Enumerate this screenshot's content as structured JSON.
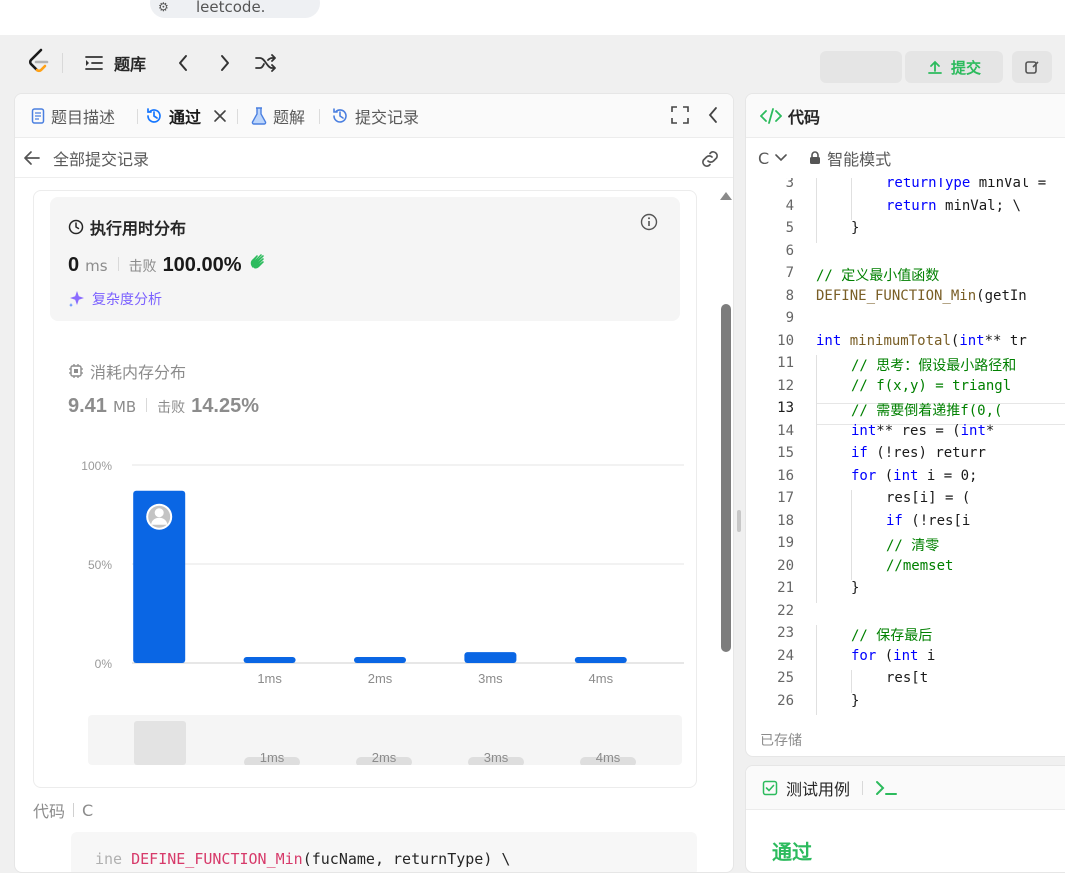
{
  "url_fragment": {
    "text": "leetcode."
  },
  "topbar": {
    "problems_label": "题库",
    "submit_label": "提交"
  },
  "left_tabs": [
    {
      "label": "题目描述",
      "icon": "document-icon"
    },
    {
      "label": "通过",
      "icon": "history-icon",
      "active": true
    },
    {
      "label": "题解",
      "icon": "flask-icon"
    },
    {
      "label": "提交记录",
      "icon": "history-icon"
    }
  ],
  "sub_header": {
    "back_label": "全部提交记录"
  },
  "runtime": {
    "title": "执行用时分布",
    "value": "0",
    "unit": "ms",
    "beats_label": "击败",
    "beats_value": "100.00%",
    "complexity_link": "复杂度分析"
  },
  "memory": {
    "title": "消耗内存分布",
    "value": "9.41",
    "unit": "MB",
    "beats_label": "击败",
    "beats_value": "14.25%"
  },
  "chart_data": {
    "type": "bar",
    "categories": [
      "0ms",
      "1ms",
      "2ms",
      "3ms",
      "4ms"
    ],
    "x_tick_labels": [
      "",
      "1ms",
      "2ms",
      "3ms",
      "4ms"
    ],
    "values": [
      87,
      3,
      3,
      5.5,
      3
    ],
    "y_tick_labels": [
      "100%",
      "50%",
      "0%"
    ],
    "ylim": [
      0,
      100
    ],
    "highlight_index": 0,
    "bar_color": "#0a66e4",
    "minimap_labels": [
      "1ms",
      "2ms",
      "3ms",
      "4ms"
    ],
    "grid": true
  },
  "code_section": {
    "label": "代码",
    "language": "C",
    "snippet_prefix": "ine ",
    "snippet_macro": "DEFINE_FUNCTION_Min",
    "snippet_rest": "(fucName, returnType) \\"
  },
  "editor": {
    "title": "代码",
    "language": "C",
    "mode": "智能模式",
    "saved_label": "已存储",
    "current_line": 13,
    "lines": [
      {
        "n": "3",
        "indent": 2,
        "text": "returnType minVal ="
      },
      {
        "n": "4",
        "indent": 2,
        "text": "return minVal; \\"
      },
      {
        "n": "5",
        "indent": 1,
        "text": "}"
      },
      {
        "n": "6",
        "indent": 0,
        "text": ""
      },
      {
        "n": "7",
        "indent": 0,
        "text": "// 定义最小值函数"
      },
      {
        "n": "8",
        "indent": 0,
        "text": "DEFINE_FUNCTION_Min(getIn"
      },
      {
        "n": "9",
        "indent": 0,
        "text": ""
      },
      {
        "n": "10",
        "indent": 0,
        "text": "int minimumTotal(int** tr"
      },
      {
        "n": "11",
        "indent": 1,
        "text": "// 思考：假设最小路径和"
      },
      {
        "n": "12",
        "indent": 1,
        "text": "// f(x,y) = triangl"
      },
      {
        "n": "13",
        "indent": 1,
        "text": "// 需要倒着递推f(0,("
      },
      {
        "n": "14",
        "indent": 1,
        "text": "int** res = (int*"
      },
      {
        "n": "15",
        "indent": 1,
        "text": "if (!res) returr"
      },
      {
        "n": "16",
        "indent": 1,
        "text": "for (int i = 0;"
      },
      {
        "n": "17",
        "indent": 2,
        "text": "res[i] = ("
      },
      {
        "n": "18",
        "indent": 2,
        "text": "if (!res[i"
      },
      {
        "n": "19",
        "indent": 2,
        "text": "// 清零"
      },
      {
        "n": "20",
        "indent": 2,
        "text": "//memset"
      },
      {
        "n": "21",
        "indent": 1,
        "text": "}"
      },
      {
        "n": "22",
        "indent": 0,
        "text": ""
      },
      {
        "n": "23",
        "indent": 1,
        "text": "// 保存最后"
      },
      {
        "n": "24",
        "indent": 1,
        "text": "for (int i"
      },
      {
        "n": "25",
        "indent": 2,
        "text": "res[t"
      },
      {
        "n": "26",
        "indent": 1,
        "text": "}"
      }
    ]
  },
  "test_panel": {
    "tab_label": "测试用例",
    "result_label": "通过"
  }
}
